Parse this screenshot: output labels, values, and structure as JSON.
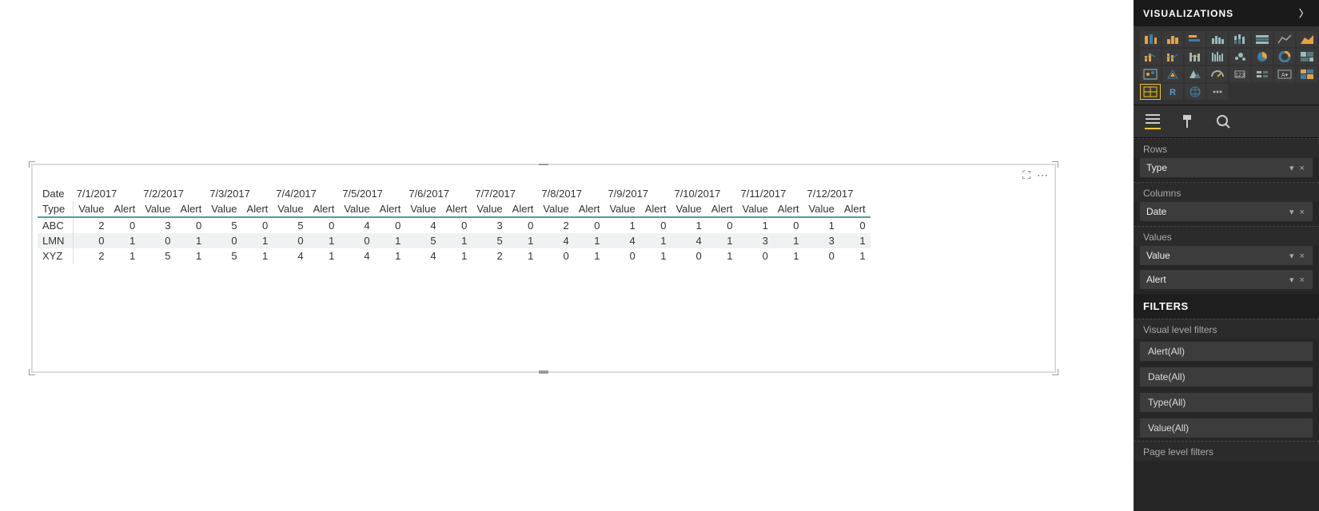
{
  "side": {
    "title": "VISUALIZATIONS",
    "rows_label": "Rows",
    "rows_field": "Type",
    "cols_label": "Columns",
    "cols_field": "Date",
    "values_label": "Values",
    "value_field": "Value",
    "alert_field": "Alert",
    "filters_title": "FILTERS",
    "vlf_label": "Visual level filters",
    "filter_alert": "Alert(All)",
    "filter_date": "Date(All)",
    "filter_type": "Type(All)",
    "filter_value": "Value(All)",
    "plf_label": "Page level filters"
  },
  "matrix": {
    "corner_top": "Date",
    "corner_bottom": "Type",
    "value_h": "Value",
    "alert_h": "Alert",
    "dates": [
      "7/1/2017",
      "7/2/2017",
      "7/3/2017",
      "7/4/2017",
      "7/5/2017",
      "7/6/2017",
      "7/7/2017",
      "7/8/2017",
      "7/9/2017",
      "7/10/2017",
      "7/11/2017",
      "7/12/2017"
    ],
    "rows": [
      {
        "type": "ABC",
        "vals": [
          [
            2,
            0
          ],
          [
            3,
            0
          ],
          [
            5,
            0
          ],
          [
            5,
            0
          ],
          [
            4,
            0
          ],
          [
            4,
            0
          ],
          [
            3,
            0
          ],
          [
            2,
            0
          ],
          [
            1,
            0
          ],
          [
            1,
            0
          ],
          [
            1,
            0
          ],
          [
            1,
            0
          ]
        ]
      },
      {
        "type": "LMN",
        "vals": [
          [
            0,
            1
          ],
          [
            0,
            1
          ],
          [
            0,
            1
          ],
          [
            0,
            1
          ],
          [
            0,
            1
          ],
          [
            5,
            1
          ],
          [
            5,
            1
          ],
          [
            4,
            1
          ],
          [
            4,
            1
          ],
          [
            4,
            1
          ],
          [
            3,
            1
          ],
          [
            3,
            1
          ]
        ]
      },
      {
        "type": "XYZ",
        "vals": [
          [
            2,
            1
          ],
          [
            5,
            1
          ],
          [
            5,
            1
          ],
          [
            4,
            1
          ],
          [
            4,
            1
          ],
          [
            4,
            1
          ],
          [
            2,
            1
          ],
          [
            0,
            1
          ],
          [
            0,
            1
          ],
          [
            0,
            1
          ],
          [
            0,
            1
          ],
          [
            0,
            1
          ]
        ]
      }
    ]
  }
}
